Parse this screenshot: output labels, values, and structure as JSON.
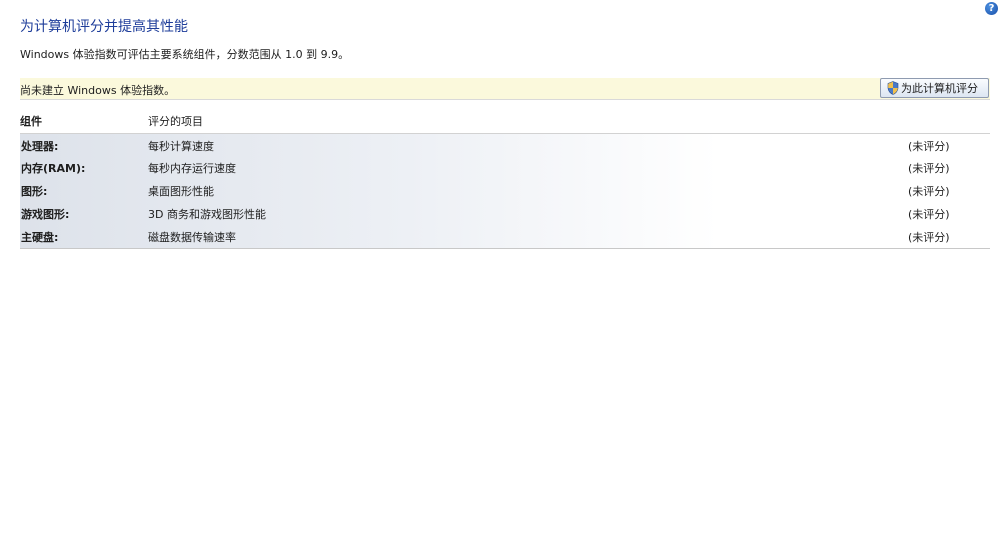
{
  "help": {
    "glyph": "?"
  },
  "header": {
    "title": "为计算机评分并提高其性能",
    "description": "Windows 体验指数可评估主要系统组件，分数范围从 1.0 到 9.9。"
  },
  "status": {
    "message": "尚未建立 Windows 体验指数。",
    "rate_button_label": "为此计算机评分"
  },
  "table": {
    "headers": {
      "component": "组件",
      "rated_item": "评分的项目"
    },
    "rows": [
      {
        "component": "处理器:",
        "item": "每秒计算速度",
        "score": "(未评分)"
      },
      {
        "component": "内存(RAM):",
        "item": "每秒内存运行速度",
        "score": "(未评分)"
      },
      {
        "component": "图形:",
        "item": "桌面图形性能",
        "score": "(未评分)"
      },
      {
        "component": "游戏图形:",
        "item": "3D 商务和游戏图形性能",
        "score": "(未评分)"
      },
      {
        "component": "主硬盘:",
        "item": "磁盘数据传输速率",
        "score": "(未评分)"
      }
    ]
  },
  "colors": {
    "title": "#1e3d9a",
    "status_bar_bg": "#fbf9dc",
    "row_gradient_start": "#dde2ea"
  },
  "icons": {
    "help": "help-icon",
    "rate_button": "shield-icon"
  }
}
